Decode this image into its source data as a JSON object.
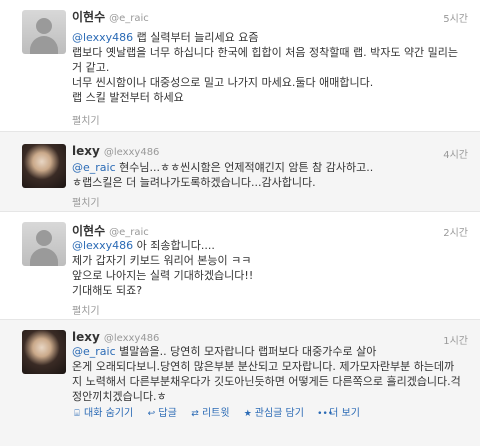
{
  "tweets": [
    {
      "name": "이현수",
      "handle": "@e_raic",
      "time": "5시간",
      "mention": "@lexxy486",
      "text_first": " 랩 실력부터 늘리세요 요즘",
      "text_rest": "랩보다 옛날랩을 너무 하십니다 한국에 힙합이  처음 정착할때 랩. 박자도 약간 밀리는거 같고.\n너무 씬시함이나 대중성으로 밀고 나가지 마세요.둘다 애매합니다.\n랩 스킬 발전부터 하세요",
      "expand": "펼치기"
    },
    {
      "name": "lexy",
      "handle": "@lexxy486",
      "time": "4시간",
      "mention": "@e_raic",
      "text_first": " 현수님...ㅎㅎ씬시함은 언제적얘긴지 암튼 참 감사하고..",
      "text_rest": "ㅎ랩스킬은 더 늘려나가도록하겠습니다...감사합니다.",
      "expand": "펼치기"
    },
    {
      "name": "이현수",
      "handle": "@e_raic",
      "time": "2시간",
      "mention": "@lexxy486",
      "text_first": " 아 죄송합니다....",
      "text_rest": "제가 갑자기 키보드 워리어 본능이 ㅋㅋ\n앞으로 나아지는 실력 기대하겠습니다!!\n기대해도 되죠?",
      "expand": "펼치기"
    },
    {
      "name": "lexy",
      "handle": "@lexxy486",
      "time": "1시간",
      "mention": "@e_raic",
      "text_first": " 별말씀을.. 당연히 모자랍니다 랩퍼보다 대중가수로 살아",
      "text_rest": "온게 오래되다보니.당연히 많은부분 분산되고 모자랍니다. 제가모자란부분 하는데까지 노력해서 다른부분채우다가 깃도아닌듯하면 어떻게든 다른쪽으로 흘리겠습니다.걱정안끼치겠습니다.ㅎ",
      "actions": {
        "hide": "대화 숨기기",
        "reply": "답글",
        "retweet": "리트윗",
        "favorite": "관심글 담기",
        "more": "더 보기"
      }
    }
  ],
  "icons": {
    "hide": "conversation-icon",
    "reply": "reply-icon",
    "retweet": "retweet-icon",
    "favorite": "star-icon",
    "more": "more-icon"
  },
  "colors": {
    "link": "#2a6ab5",
    "muted": "#999999"
  }
}
